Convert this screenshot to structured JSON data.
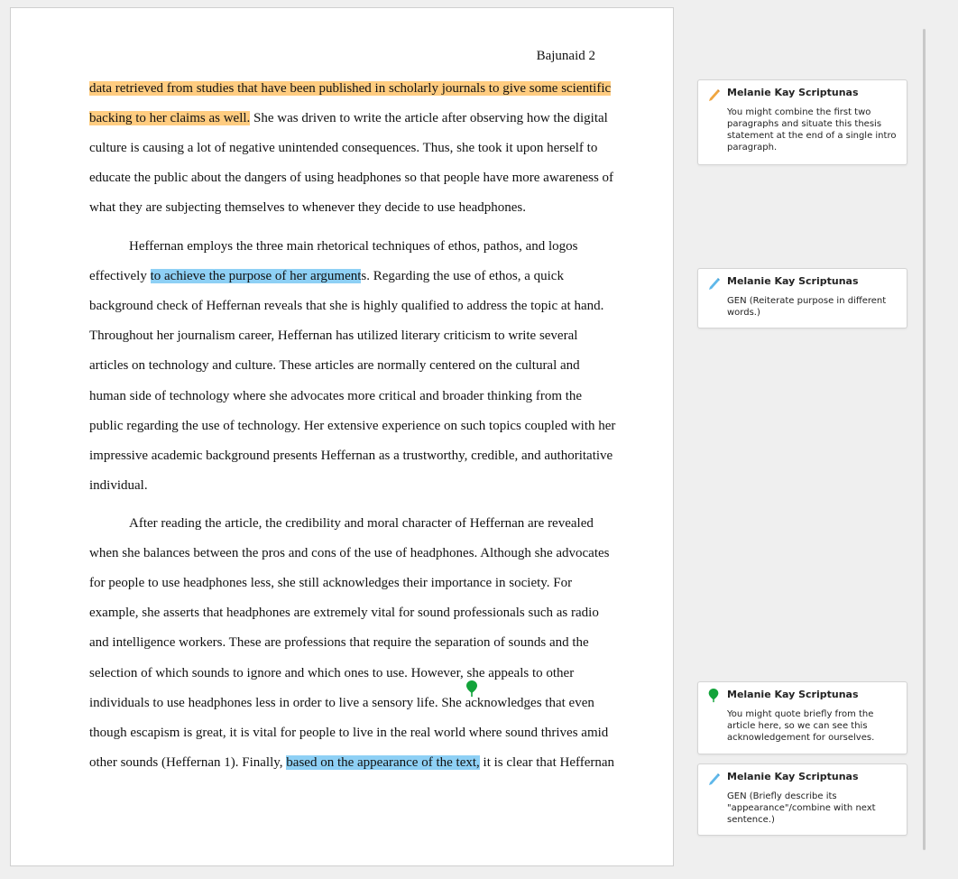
{
  "page": {
    "header": "Bajunaid 2"
  },
  "document": {
    "lines": [
      {
        "segments": [
          {
            "text": "data retrieved from studies that have been published in scholarly journals to give some scientific",
            "hl": "orange"
          }
        ]
      },
      {
        "segments": [
          {
            "text": "backing to her claims as well.",
            "hl": "orange"
          },
          {
            "text": " She was driven to write the article after observing how the digital",
            "hl": ""
          }
        ]
      },
      {
        "segments": [
          {
            "text": "culture is causing a lot of negative unintended consequences. Thus, she took it upon herself to",
            "hl": ""
          }
        ]
      },
      {
        "segments": [
          {
            "text": "educate the public about the dangers of using headphones so that people have more awareness of",
            "hl": ""
          }
        ]
      },
      {
        "segments": [
          {
            "text": "what they are subjecting themselves to whenever they decide to use headphones.",
            "hl": ""
          }
        ]
      },
      {
        "indent": true,
        "segments": [
          {
            "text": "Heffernan employs the three main rhetorical techniques of ethos, pathos, and logos",
            "hl": ""
          }
        ]
      },
      {
        "segments": [
          {
            "text": "effectively ",
            "hl": ""
          },
          {
            "text": "to achieve the purpose of her argument",
            "hl": "blue"
          },
          {
            "text": "s. Regarding the use of ethos, a quick",
            "hl": ""
          }
        ]
      },
      {
        "segments": [
          {
            "text": "background check of Heffernan reveals that she is highly qualified to address the topic at hand.",
            "hl": ""
          }
        ]
      },
      {
        "segments": [
          {
            "text": "Throughout her journalism career, Heffernan has utilized literary criticism to write several",
            "hl": ""
          }
        ]
      },
      {
        "segments": [
          {
            "text": "articles on technology and culture. These articles are normally centered on the cultural and",
            "hl": ""
          }
        ]
      },
      {
        "segments": [
          {
            "text": "human side of technology where she advocates more critical and broader thinking from the",
            "hl": ""
          }
        ]
      },
      {
        "segments": [
          {
            "text": "public regarding the use of technology. Her extensive experience on such topics coupled with her",
            "hl": ""
          }
        ]
      },
      {
        "segments": [
          {
            "text": "impressive academic background presents Heffernan as a trustworthy, credible, and authoritative",
            "hl": ""
          }
        ]
      },
      {
        "segments": [
          {
            "text": "individual.",
            "hl": ""
          }
        ]
      },
      {
        "indent": true,
        "segments": [
          {
            "text": "After reading the article, the credibility and moral character of Heffernan are revealed",
            "hl": ""
          }
        ]
      },
      {
        "segments": [
          {
            "text": "when she balances between the pros and cons of the use of headphones. Although she advocates",
            "hl": ""
          }
        ]
      },
      {
        "segments": [
          {
            "text": "for people to use headphones less, she still acknowledges their importance in society. For",
            "hl": ""
          }
        ]
      },
      {
        "segments": [
          {
            "text": "example, she asserts that headphones are extremely vital for sound professionals such as radio",
            "hl": ""
          }
        ]
      },
      {
        "segments": [
          {
            "text": "and intelligence workers. These are professions that require the separation of sounds and the",
            "hl": ""
          }
        ]
      },
      {
        "segments": [
          {
            "text": "selection of which sounds to ignore and which ones to use. However, she appeals to other",
            "hl": ""
          }
        ]
      },
      {
        "segments": [
          {
            "text": "individuals to use headphones less in order to live a sensory life. She acknowledges that even",
            "hl": ""
          }
        ]
      },
      {
        "segments": [
          {
            "text": "though escapism is great, it is vital for people to live in the real world where sound thrives amid",
            "hl": ""
          }
        ]
      },
      {
        "segments": [
          {
            "text": "other sounds (Heffernan 1). Finally, ",
            "hl": ""
          },
          {
            "text": "based on the appearance of the text,",
            "hl": "blue"
          },
          {
            "text": " it is clear that Heffernan",
            "hl": ""
          }
        ]
      }
    ]
  },
  "comments": [
    {
      "author": "Melanie Kay Scriptunas",
      "text": "You might combine the first two paragraphs and situate this thesis statement at the end of a single intro paragraph.",
      "icon": "pencil-orange-icon"
    },
    {
      "author": "Melanie Kay Scriptunas",
      "text": "GEN (Reiterate purpose in different words.)",
      "icon": "pencil-blue-icon"
    },
    {
      "author": "Melanie Kay Scriptunas",
      "text": "You might quote briefly from the article here, so we can see this acknowledgement for ourselves.",
      "icon": "pin-green-icon"
    },
    {
      "author": "Melanie Kay Scriptunas",
      "text": "GEN (Briefly describe its \"appearance\"/combine with next sentence.)",
      "icon": "pencil-blue-icon"
    }
  ],
  "colors": {
    "highlight_orange": "#ffcc80",
    "highlight_blue": "#8ed0f5",
    "pin_green": "#12a33a"
  }
}
